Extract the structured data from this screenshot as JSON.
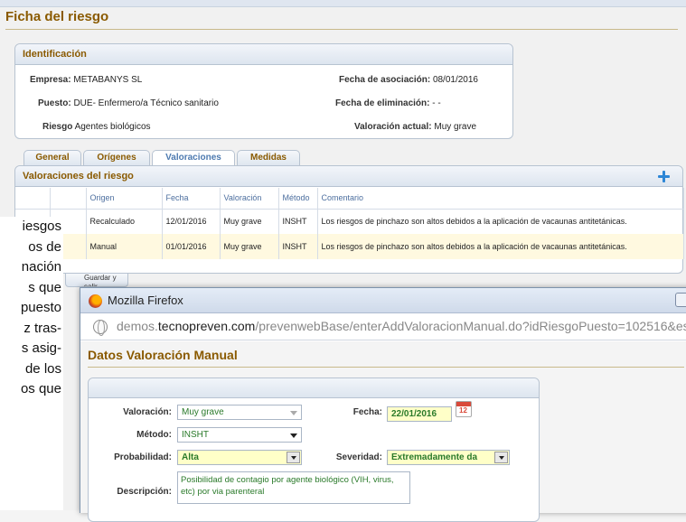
{
  "ficha": {
    "title": "Ficha del riesgo"
  },
  "identificacion": {
    "title": "Identificación",
    "empresa_label": "Empresa:",
    "empresa_value": "METABANYS SL",
    "puesto_label": "Puesto:",
    "puesto_value": "DUE- Enfermero/a Técnico sanitario",
    "riesgo_label": "Riesgo",
    "riesgo_value": "Agentes biológicos",
    "fecha_asoc_label": "Fecha de asociación:",
    "fecha_asoc_value": "08/01/2016",
    "fecha_elim_label": "Fecha de eliminación:",
    "fecha_elim_value": "- -",
    "valoracion_label": "Valoración actual:",
    "valoracion_value": "Muy grave"
  },
  "tabs": [
    {
      "label": "General"
    },
    {
      "label": "Orígenes"
    },
    {
      "label": "Valoraciones",
      "active": true
    },
    {
      "label": "Medidas"
    }
  ],
  "valoraciones": {
    "title": "Valoraciones del riesgo",
    "columns": [
      "Origen",
      "Fecha",
      "Valoración",
      "Método",
      "Comentario"
    ],
    "rows": [
      {
        "origen": "Recalculado",
        "fecha": "12/01/2016",
        "valoracion": "Muy grave",
        "metodo": "INSHT",
        "comentario": "Los riesgos de pinchazo son altos debidos a la aplicación de vacaunas antitetánicas."
      },
      {
        "origen": "Manual",
        "fecha": "01/01/2016",
        "valoracion": "Muy grave",
        "metodo": "INSHT",
        "comentario": "Los riesgos de pinchazo son altos debidos a la aplicación de vacaunas antitetánicas."
      }
    ]
  },
  "overlay_text": [
    "iesgos",
    "os de",
    "nación",
    "s que",
    "puesto",
    "z tras-",
    "s asig-",
    "de los",
    "os que"
  ],
  "bottom_tab": {
    "label": "Guardar y salir"
  },
  "firefox": {
    "title": "Mozilla Firefox",
    "url_prefix": "demos.",
    "url_domain": "tecnopreven.com",
    "url_path": "/prevenwebBase/enterAddValoracionManual.do?idRiesgoPuesto=102516&es"
  },
  "form": {
    "title": "Datos Valoración Manual",
    "valoracion_label": "Valoración:",
    "valoracion_value": "Muy grave",
    "fecha_label": "Fecha:",
    "fecha_value": "22/01/2016",
    "calendar_day": "12",
    "metodo_label": "Método:",
    "metodo_value": "INSHT",
    "probabilidad_label": "Probabilidad:",
    "probabilidad_value": "Alta",
    "severidad_label": "Severidad:",
    "severidad_value": "Extremadamente da",
    "descripcion_label": "Descripción:",
    "descripcion_value": "Posibilidad de contagio por agente biológico (VIH, virus, etc) por via parenteral"
  }
}
